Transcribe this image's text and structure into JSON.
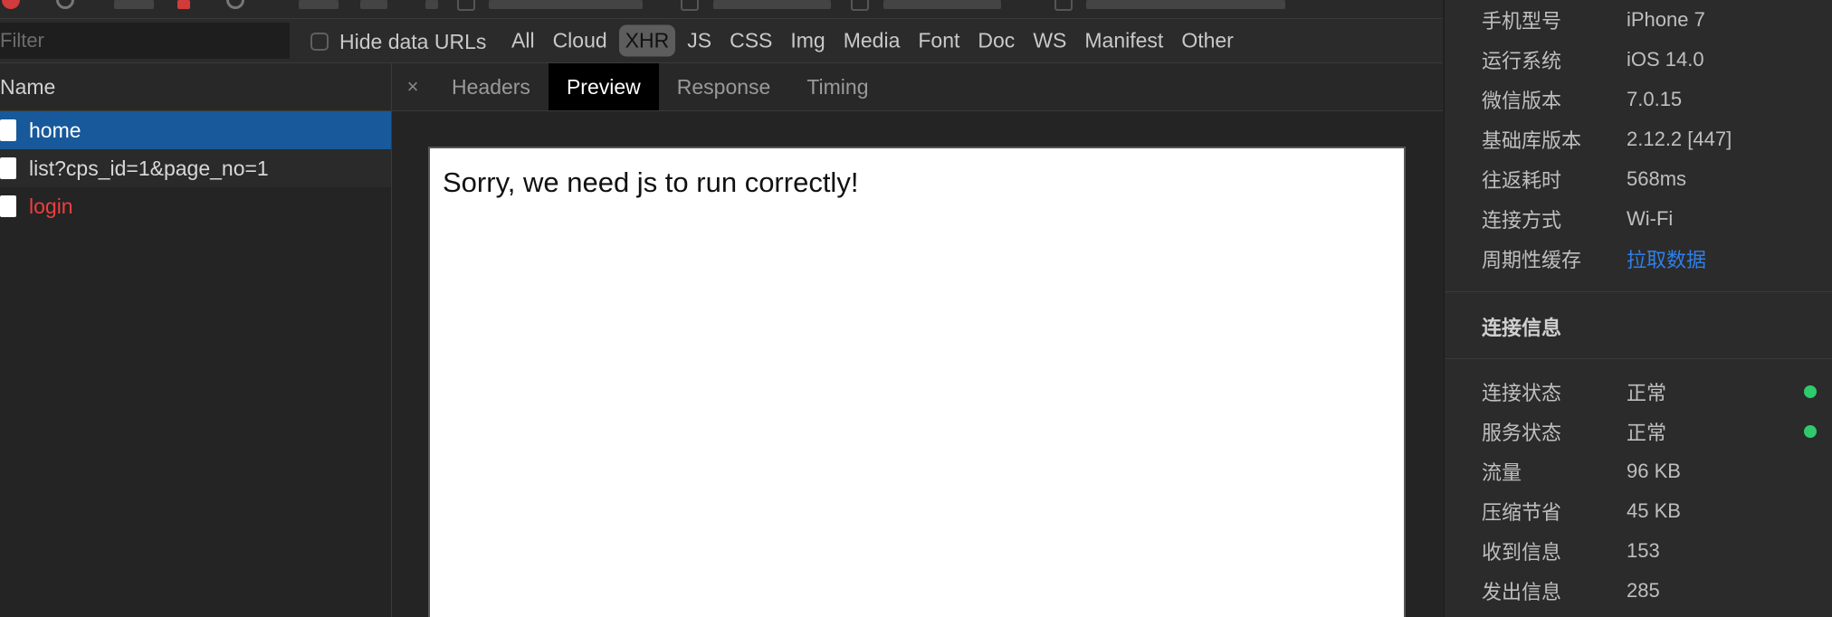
{
  "filter": {
    "placeholder": "Filter",
    "hide_data_urls_label": "Hide data URLs"
  },
  "type_filters": [
    {
      "label": "All",
      "active": false
    },
    {
      "label": "Cloud",
      "active": false
    },
    {
      "label": "XHR",
      "active": true
    },
    {
      "label": "JS",
      "active": false
    },
    {
      "label": "CSS",
      "active": false
    },
    {
      "label": "Img",
      "active": false
    },
    {
      "label": "Media",
      "active": false
    },
    {
      "label": "Font",
      "active": false
    },
    {
      "label": "Doc",
      "active": false
    },
    {
      "label": "WS",
      "active": false
    },
    {
      "label": "Manifest",
      "active": false
    },
    {
      "label": "Other",
      "active": false
    }
  ],
  "request_list": {
    "header": "Name",
    "rows": [
      {
        "name": "home",
        "state": "selected"
      },
      {
        "name": "list?cps_id=1&page_no=1",
        "state": "normal"
      },
      {
        "name": "login",
        "state": "error"
      }
    ]
  },
  "detail": {
    "close_symbol": "×",
    "tabs": [
      {
        "label": "Headers",
        "active": false
      },
      {
        "label": "Preview",
        "active": true
      },
      {
        "label": "Response",
        "active": false
      },
      {
        "label": "Timing",
        "active": false
      }
    ],
    "preview_text": "Sorry, we need js to run correctly!"
  },
  "device_info": [
    {
      "key": "手机型号",
      "value": "iPhone 7"
    },
    {
      "key": "运行系统",
      "value": "iOS 14.0"
    },
    {
      "key": "微信版本",
      "value": "7.0.15"
    },
    {
      "key": "基础库版本",
      "value": "2.12.2 [447]"
    },
    {
      "key": "往返耗时",
      "value": "568ms"
    },
    {
      "key": "连接方式",
      "value": "Wi-Fi"
    },
    {
      "key": "周期性缓存",
      "value": "拉取数据",
      "link": true
    }
  ],
  "connection": {
    "title": "连接信息",
    "rows": [
      {
        "key": "连接状态",
        "value": "正常",
        "status": "ok"
      },
      {
        "key": "服务状态",
        "value": "正常",
        "status": "ok"
      },
      {
        "key": "流量",
        "value": "96 KB"
      },
      {
        "key": "压缩节省",
        "value": "45 KB"
      },
      {
        "key": "收到信息",
        "value": "153"
      },
      {
        "key": "发出信息",
        "value": "285"
      }
    ]
  },
  "colors": {
    "selected_row": "#17599a",
    "error_text": "#ef3f3f",
    "link": "#2f7fea",
    "status_ok": "#2ecb6c"
  }
}
